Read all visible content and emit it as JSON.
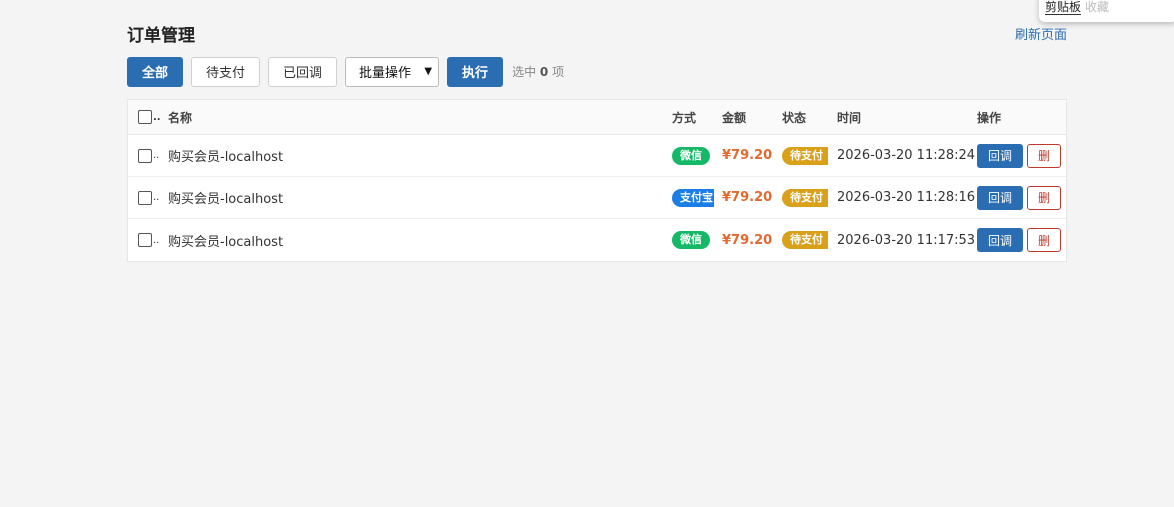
{
  "clipboard": {
    "tab_active": "剪贴板",
    "tab_other": "收藏"
  },
  "page": {
    "title": "订单管理",
    "refresh_label": "刷新页面"
  },
  "toolbar": {
    "filter_all": "全部",
    "filter_pending": "待支付",
    "filter_callback": "已回调",
    "batch_select": "批量操作",
    "execute": "执行",
    "selected_prefix": "选中",
    "selected_count": "0",
    "selected_suffix": "项"
  },
  "table": {
    "headers": {
      "name": "名称",
      "method": "方式",
      "amount": "金额",
      "status": "状态",
      "time": "时间",
      "ops": "操作"
    },
    "header_chk_suffix": "..",
    "rows": [
      {
        "name": "购买会员-localhost",
        "method": "微信",
        "amount": "¥79.20",
        "status": "待支付",
        "time": "2026-03-20 11:28:24",
        "op_callback": "回调",
        "op_delete": "删"
      },
      {
        "name": "购买会员-localhost",
        "method": "支付宝",
        "amount": "¥79.20",
        "status": "待支付",
        "time": "2026-03-20 11:28:16",
        "op_callback": "回调",
        "op_delete": "删"
      },
      {
        "name": "购买会员-localhost",
        "method": "微信",
        "amount": "¥79.20",
        "status": "待支付",
        "time": "2026-03-20 11:17:53",
        "op_callback": "回调",
        "op_delete": "删"
      }
    ]
  },
  "colors": {
    "primary": "#2a6db2",
    "wechat": "#14b866",
    "alipay": "#1b7ee6",
    "pending": "#d9a11a",
    "amount": "#e2692f",
    "danger": "#c0392b"
  },
  "icons": {
    "checkbox": "checkbox-icon",
    "caret": "chevron-down-icon"
  }
}
